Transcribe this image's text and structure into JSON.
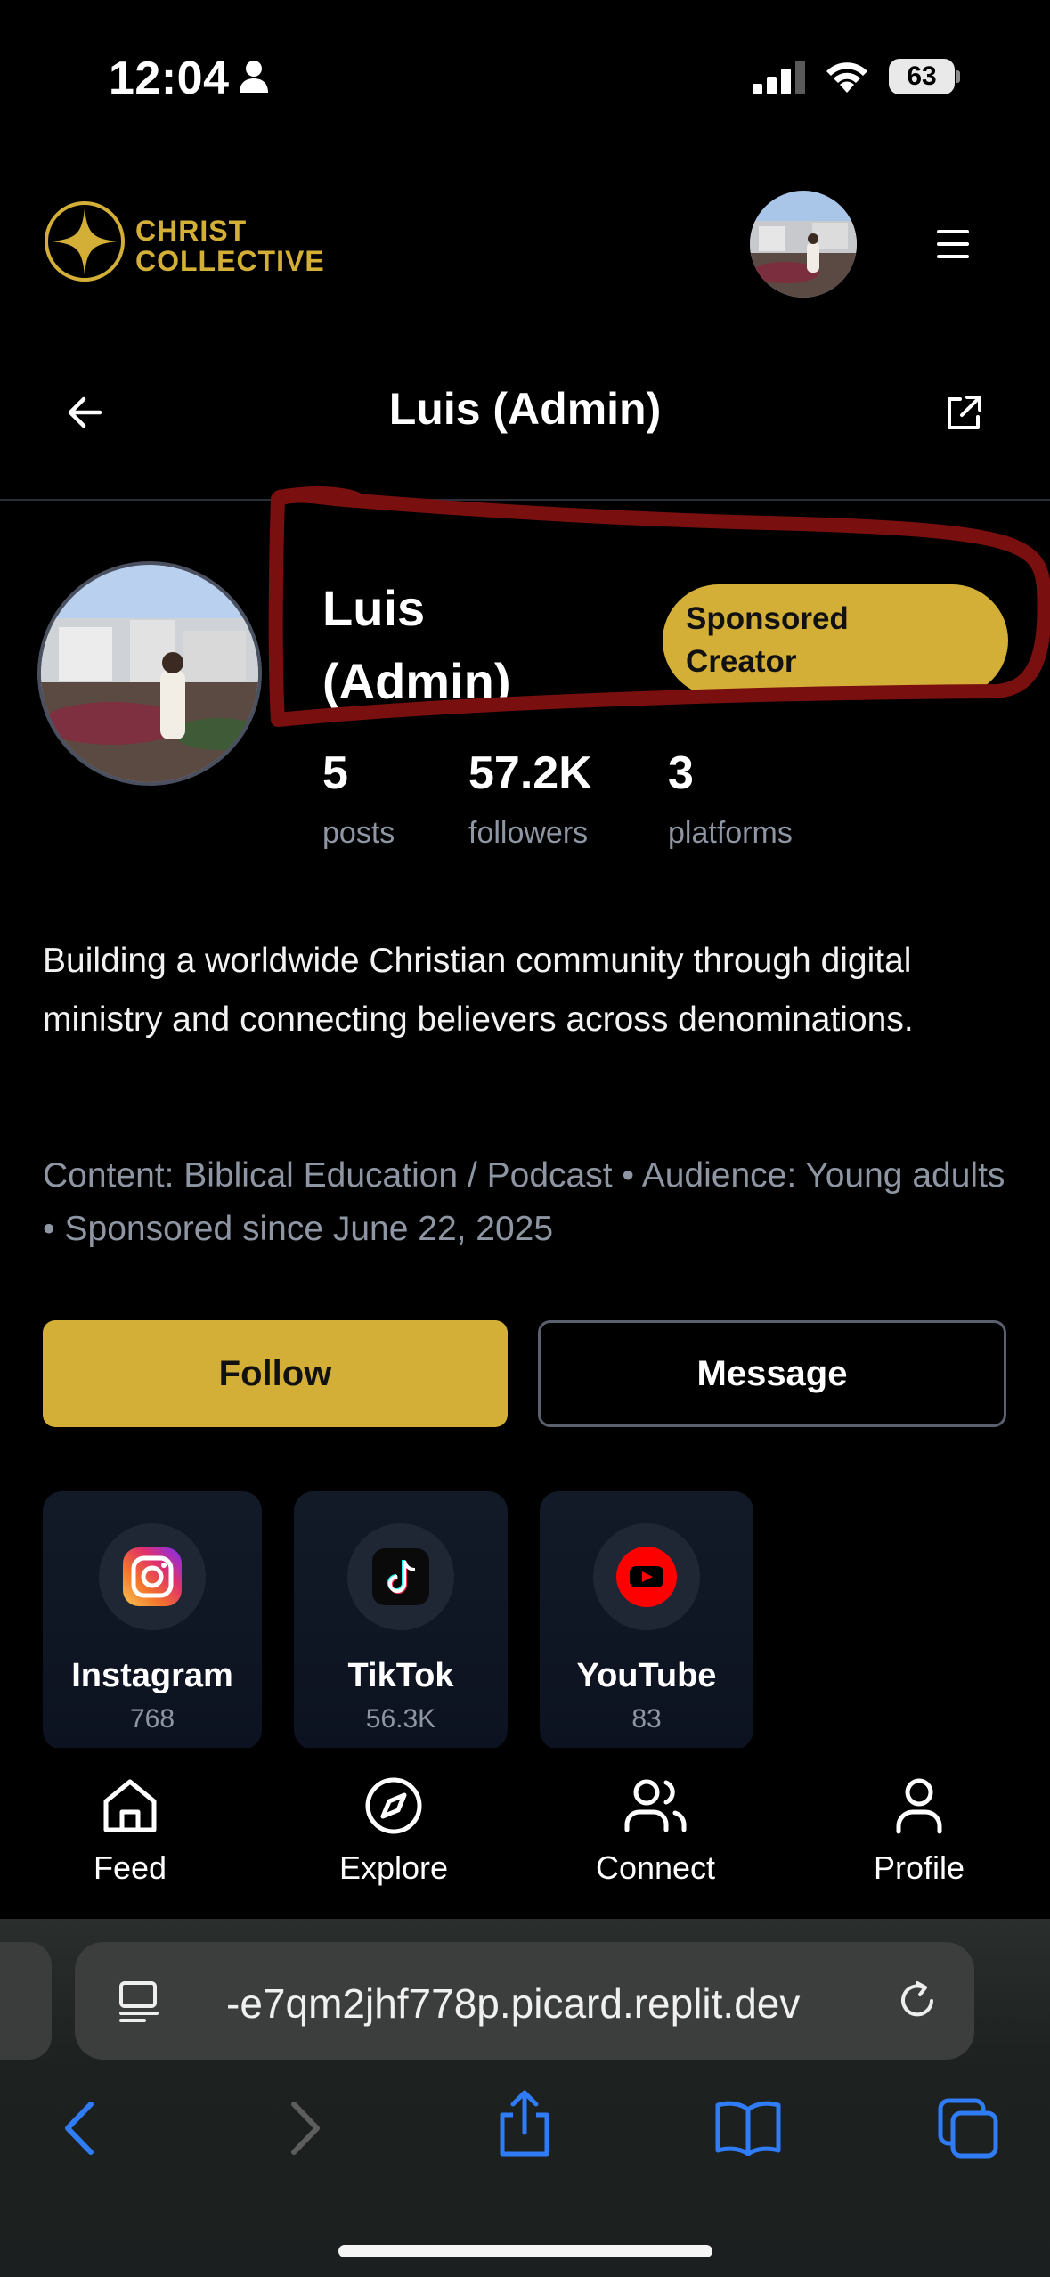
{
  "status_bar": {
    "time": "12:04",
    "battery": "63"
  },
  "header": {
    "logo_line1": "CHRIST",
    "logo_line2": "COLLECTIVE",
    "accent": "#d4af37"
  },
  "page": {
    "title": "Luis (Admin)"
  },
  "profile": {
    "name_line1": "Luis",
    "name_line2": "(Admin)",
    "badge_line1": "Sponsored",
    "badge_line2": "Creator",
    "stats": [
      {
        "value": "5",
        "label": "posts"
      },
      {
        "value": "57.2K",
        "label": "followers"
      },
      {
        "value": "3",
        "label": "platforms"
      }
    ],
    "bio": "Building a worldwide Christian community through digital ministry and connecting believers across denominations.",
    "meta": "Content: Biblical Education / Podcast • Audience: Young adults • Sponsored since June 22, 2025"
  },
  "actions": {
    "follow": "Follow",
    "message": "Message"
  },
  "platforms": [
    {
      "name": "Instagram",
      "count": "768",
      "icon": "instagram-icon"
    },
    {
      "name": "TikTok",
      "count": "56.3K",
      "icon": "tiktok-icon"
    },
    {
      "name": "YouTube",
      "count": "83",
      "icon": "youtube-icon"
    }
  ],
  "nav": [
    {
      "label": "Feed",
      "icon": "home-icon"
    },
    {
      "label": "Explore",
      "icon": "compass-icon"
    },
    {
      "label": "Connect",
      "icon": "users-icon"
    },
    {
      "label": "Profile",
      "icon": "user-icon"
    }
  ],
  "browser": {
    "url": "-e7qm2jhf778p.picard.replit.dev"
  }
}
